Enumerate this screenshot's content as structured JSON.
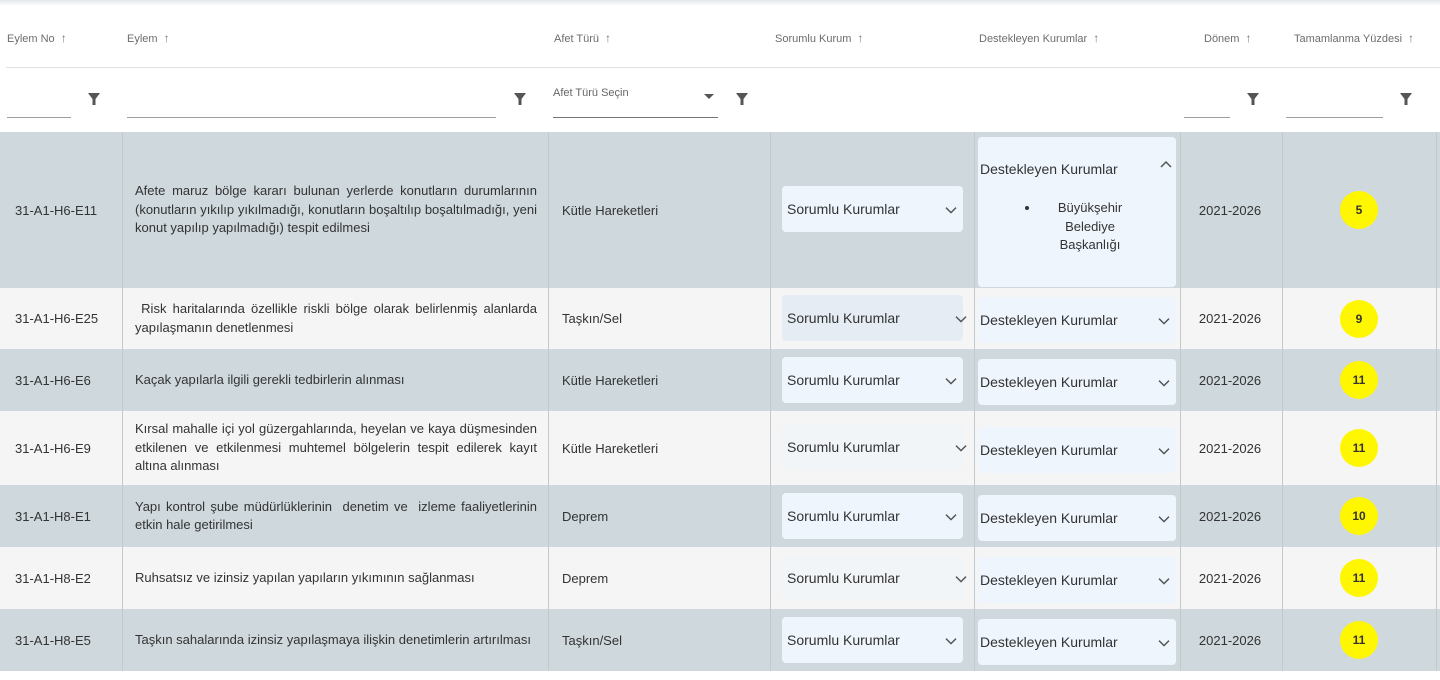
{
  "headers": {
    "eylem_no": "Eylem No",
    "eylem": "Eylem",
    "afet_turu": "Afet Türü",
    "sorumlu_kurum": "Sorumlu Kurum",
    "destekleyen_kurumlar": "Destekleyen Kurumlar",
    "donem": "Dönem",
    "tamamlanma": "Tamamlanma Yüzdesi",
    "sort_glyph": "↑"
  },
  "filters": {
    "afet_select_label": "Afet Türü Seçin",
    "eylem_no_value": "",
    "eylem_value": "",
    "donem_value": "",
    "tamamlanma_value": ""
  },
  "rows": [
    {
      "no": "31-A1-H6-E11",
      "eylem": "Afete maruz bölge kararı bulunan yerlerde konutların durumlarının (konutların yıkılıp yıkılmadığı, konutların boşaltılıp boşaltılmadığı, yeni konut yapılıp yapılmadığı) tespit edilmesi",
      "afet": "Kütle Hareketleri",
      "sorumlu": "Sorumlu Kurumlar",
      "destek": "Destekleyen Kurumlar",
      "destek_items": [
        "Büyükşehir Belediye Başkanlığı"
      ],
      "donem": "2021-2026",
      "yuzde": 5
    },
    {
      "no": "31-A1-H6-E25",
      "eylem": " Risk haritalarında özellikle riskli bölge olarak belirlenmiş alanlarda yapılaşmanın denetlenmesi",
      "afet": "Taşkın/Sel",
      "sorumlu": "Sorumlu Kurumlar",
      "destek": "Destekleyen Kurumlar",
      "donem": "2021-2026",
      "yuzde": 9
    },
    {
      "no": "31-A1-H6-E6",
      "eylem": "Kaçak yapılarla ilgili gerekli tedbirlerin alınması",
      "afet": "Kütle Hareketleri",
      "sorumlu": "Sorumlu Kurumlar",
      "destek": "Destekleyen Kurumlar",
      "donem": "2021-2026",
      "yuzde": 11
    },
    {
      "no": "31-A1-H6-E9",
      "eylem": "Kırsal mahalle içi yol güzergahlarında, heyelan ve kaya düşmesinden etkilenen ve etkilenmesi muhtemel bölgelerin tespit edilerek kayıt altına alınması",
      "afet": "Kütle Hareketleri",
      "sorumlu": "Sorumlu Kurumlar",
      "destek": "Destekleyen Kurumlar",
      "donem": "2021-2026",
      "yuzde": 11
    },
    {
      "no": "31-A1-H8-E1",
      "eylem": "Yapı kontrol şube müdürlüklerinin  denetim ve  izleme faaliyetlerinin etkin hale getirilmesi",
      "afet": "Deprem",
      "sorumlu": "Sorumlu Kurumlar",
      "destek": "Destekleyen Kurumlar",
      "donem": "2021-2026",
      "yuzde": 10
    },
    {
      "no": "31-A1-H8-E2",
      "eylem": "Ruhsatsız ve izinsiz yapılan yapıların yıkımının sağlanması",
      "afet": "Deprem",
      "sorumlu": "Sorumlu Kurumlar",
      "destek": "Destekleyen Kurumlar",
      "donem": "2021-2026",
      "yuzde": 11
    },
    {
      "no": "31-A1-H8-E5",
      "eylem": "Taşkın sahalarında izinsiz yapılaşmaya ilişkin denetimlerin artırılması",
      "afet": "Taşkın/Sel",
      "sorumlu": "Sorumlu Kurumlar",
      "destek": "Destekleyen Kurumlar",
      "donem": "2021-2026",
      "yuzde": 11
    }
  ],
  "colors": {
    "row_dark": "#cfd8dc",
    "row_light": "#f5f5f5",
    "badge": "#fff700",
    "select_bg": "#eef5fd"
  },
  "icons": {
    "filter": "filter-icon",
    "sort": "arrow-up-icon",
    "dropdown": "chevron-down-icon",
    "dropdown_open": "chevron-up-icon"
  }
}
